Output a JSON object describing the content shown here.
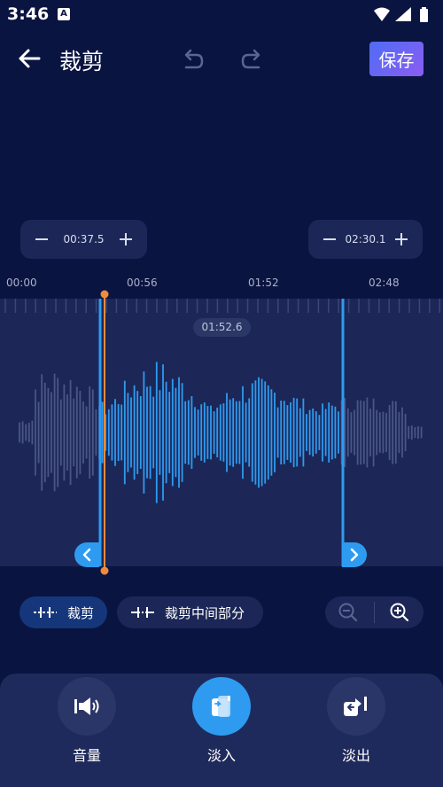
{
  "status_bar": {
    "time": "3:46",
    "indicator": "A"
  },
  "header": {
    "title": "裁剪",
    "save_label": "保存"
  },
  "trim_range": {
    "start_time": "00:37.5",
    "end_time": "02:30.1"
  },
  "ruler": {
    "ticks": [
      "00:00",
      "00:56",
      "01:52",
      "02:48"
    ]
  },
  "playhead": {
    "time": "01:52.6"
  },
  "toolbar": {
    "trim_label": "裁剪",
    "trim_middle_label": "裁剪中间部分"
  },
  "bottom_actions": [
    {
      "label": "音量",
      "icon": "volume-icon",
      "active": false
    },
    {
      "label": "淡入",
      "icon": "fade-in-icon",
      "active": true
    },
    {
      "label": "淡出",
      "icon": "fade-out-icon",
      "active": false
    }
  ],
  "colors": {
    "background": "#0a1440",
    "panel": "#1c2757",
    "accent_blue": "#2e9bf0",
    "playhead_orange": "#f08a3c",
    "save_gradient_start": "#4f6cf5",
    "save_gradient_end": "#8a5df2"
  }
}
